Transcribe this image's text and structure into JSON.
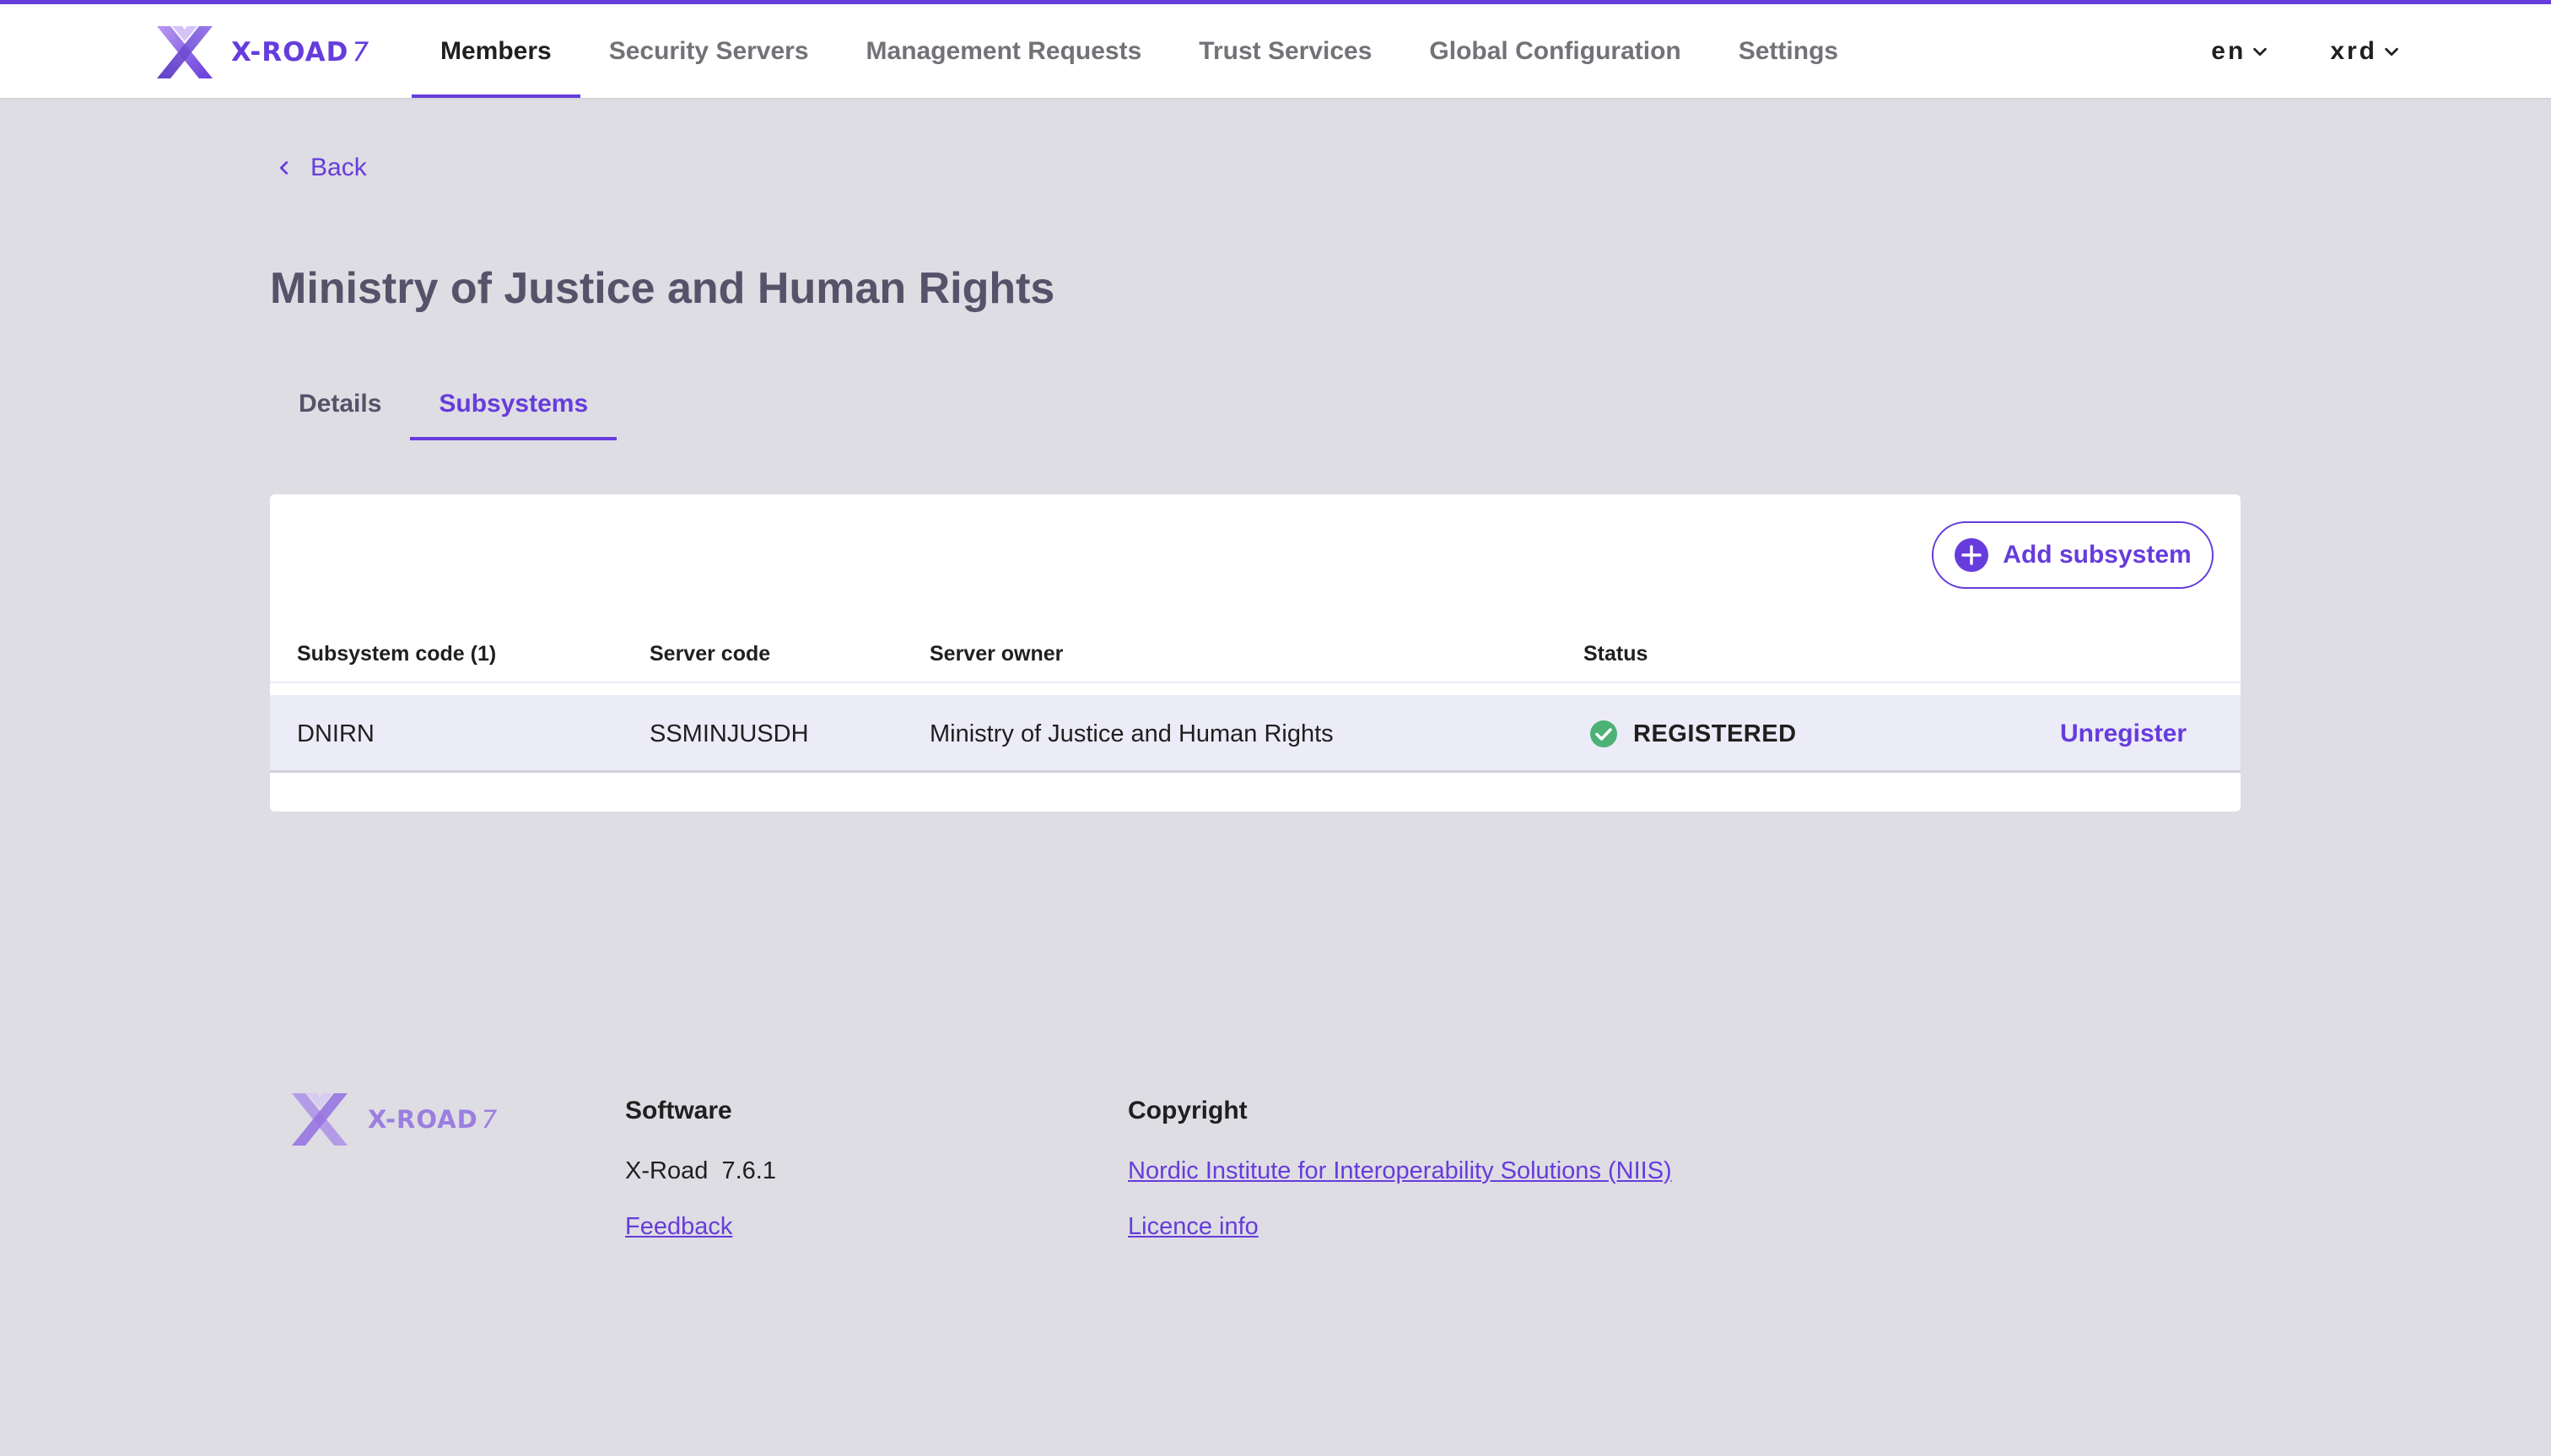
{
  "app": {
    "logo_text": "X-ROAD",
    "logo_version": "7",
    "accent_color": "#663cdc",
    "success_color": "#4cb276"
  },
  "nav": {
    "items": [
      {
        "label": "Members",
        "active": true
      },
      {
        "label": "Security Servers"
      },
      {
        "label": "Management Requests"
      },
      {
        "label": "Trust Services"
      },
      {
        "label": "Global Configuration"
      },
      {
        "label": "Settings"
      }
    ],
    "language": "en",
    "user": "xrd"
  },
  "page": {
    "back_label": "Back",
    "title": "Ministry of Justice and Human Rights",
    "tabs": [
      {
        "label": "Details"
      },
      {
        "label": "Subsystems",
        "active": true
      }
    ]
  },
  "subsystems": {
    "add_button_label": "Add subsystem",
    "columns": {
      "code": "Subsystem code (1)",
      "server_code": "Server code",
      "server_owner": "Server owner",
      "status": "Status"
    },
    "rows": [
      {
        "code": "DNIRN",
        "server_code": "SSMINJUSDH",
        "server_owner": "Ministry of Justice and Human Rights",
        "status": "REGISTERED",
        "status_icon": "check-circle-icon",
        "action": "Unregister"
      }
    ]
  },
  "footer": {
    "software_heading": "Software",
    "software_name": "X-Road",
    "software_version": "7.6.1",
    "feedback_label": "Feedback",
    "copyright_heading": "Copyright",
    "copyright_link": "Nordic Institute for Interoperability Solutions (NIIS)",
    "licence_label": "Licence info"
  }
}
